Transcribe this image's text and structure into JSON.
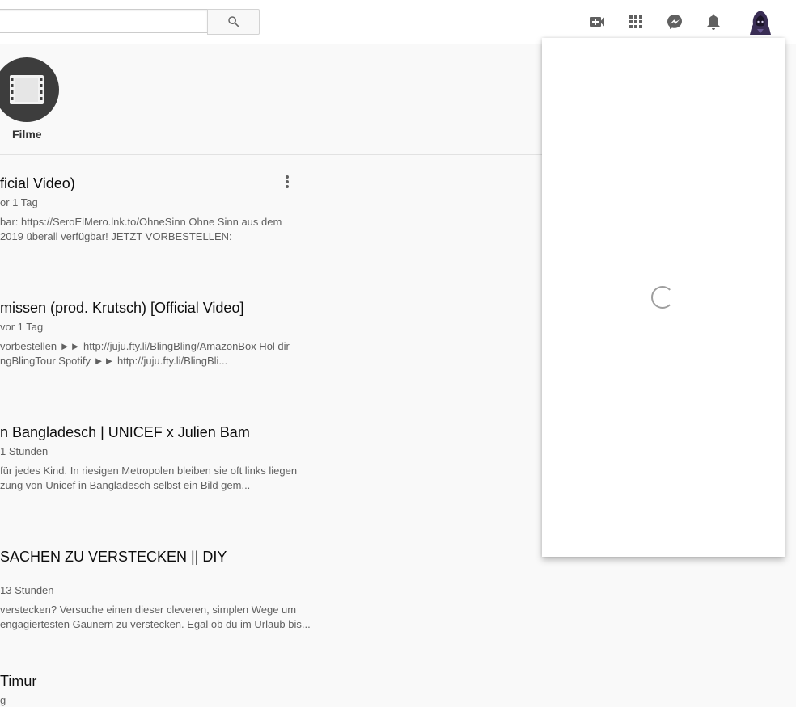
{
  "header": {
    "search": {
      "value": "",
      "placeholder": ""
    },
    "icons": [
      "create-video-icon",
      "apps-icon",
      "messages-icon",
      "notifications-icon"
    ]
  },
  "category": {
    "label": "Filme"
  },
  "videos": [
    {
      "title": "ficial Video)",
      "meta": "or 1 Tag",
      "desc1": "bar: https://SeroElMero.lnk.to/OhneSinn Ohne Sinn aus dem",
      "desc2": "2019 überall verfügbar! JETZT VORBESTELLEN:"
    },
    {
      "title": "missen (prod. Krutsch) [Official Video]",
      "meta": " vor 1 Tag",
      "desc1": "vorbestellen ►► http://juju.fty.li/BlingBling/AmazonBox Hol dir",
      "desc2": "ngBlingTour Spotify ►► http://juju.fty.li/BlingBli..."
    },
    {
      "title": "n Bangladesch | UNICEF x Julien Bam",
      "meta": "1 Stunden",
      "desc1": "für jedes Kind. In riesigen Metropolen bleiben sie oft links liegen",
      "desc2": "zung von Unicef in Bangladesch selbst ein Bild gem..."
    },
    {
      "title": "SACHEN ZU VERSTECKEN || DIY",
      "meta": " 13 Stunden",
      "desc1": "verstecken? Versuche einen dieser cleveren, simplen Wege um",
      "desc2": "engagiertesten Gaunern zu verstecken. Egal ob du im Urlaub bis..."
    },
    {
      "title": "Timur",
      "meta": "g",
      "desc1": "",
      "desc2": ""
    }
  ],
  "colors": {
    "accent": "#606060",
    "category_bg": "#3d3d3d"
  }
}
